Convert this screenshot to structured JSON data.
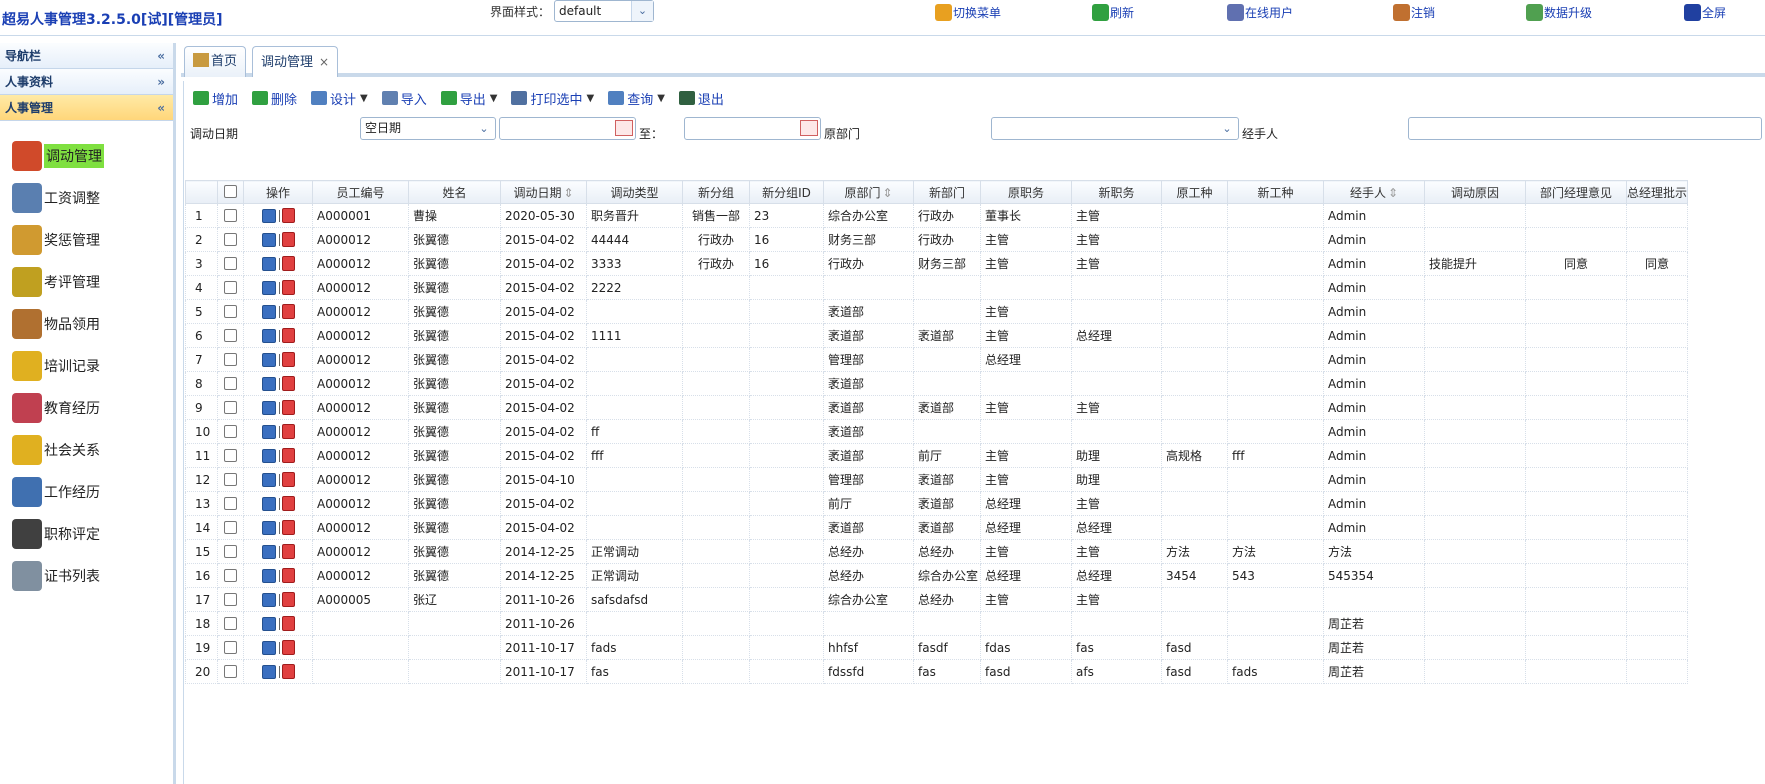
{
  "app": {
    "title": "超易人事管理3.2.5.0[试][管理员]",
    "style_label": "界面样式：",
    "style_value": "default"
  },
  "top_buttons": [
    {
      "label": "切换菜单",
      "icon": "switch-menu-icon",
      "color": "#e8a020"
    },
    {
      "label": "刷新",
      "icon": "refresh-icon",
      "color": "#30a040"
    },
    {
      "label": "在线用户",
      "icon": "online-users-icon",
      "color": "#6070b0"
    },
    {
      "label": "注销",
      "icon": "logout-icon",
      "color": "#c07030"
    },
    {
      "label": "数据升级",
      "icon": "data-upgrade-icon",
      "color": "#50a050"
    },
    {
      "label": "全屏",
      "icon": "fullscreen-icon",
      "color": "#2040a0"
    }
  ],
  "sidebar": {
    "headers": [
      {
        "label": "导航栏",
        "arrow": "«"
      },
      {
        "label": "人事资料",
        "arrow": "»"
      },
      {
        "label": "人事管理",
        "arrow": "«"
      }
    ],
    "items": [
      {
        "label": "调动管理",
        "icon": "transfer-icon",
        "color": "#d04a2a"
      },
      {
        "label": "工资调整",
        "icon": "salary-icon",
        "color": "#5a7fb0"
      },
      {
        "label": "奖惩管理",
        "icon": "reward-icon",
        "color": "#d09a30"
      },
      {
        "label": "考评管理",
        "icon": "evaluation-icon",
        "color": "#c0a020"
      },
      {
        "label": "物品领用",
        "icon": "items-icon",
        "color": "#b07030"
      },
      {
        "label": "培训记录",
        "icon": "training-icon",
        "color": "#e0b020"
      },
      {
        "label": "教育经历",
        "icon": "education-icon",
        "color": "#c04050"
      },
      {
        "label": "社会关系",
        "icon": "relations-icon",
        "color": "#e0b020"
      },
      {
        "label": "工作经历",
        "icon": "work-history-icon",
        "color": "#4070b0"
      },
      {
        "label": "职称评定",
        "icon": "title-rating-icon",
        "color": "#404040"
      },
      {
        "label": "证书列表",
        "icon": "certificate-icon",
        "color": "#8090a0"
      }
    ]
  },
  "tabs": [
    {
      "label": "首页",
      "icon": "home-icon"
    },
    {
      "label": "调动管理",
      "close": "×"
    }
  ],
  "toolbar": [
    {
      "label": "增加",
      "icon": "add-icon",
      "color": "#30a040",
      "dropdown": false
    },
    {
      "label": "删除",
      "icon": "delete-icon",
      "color": "#30a040",
      "dropdown": false
    },
    {
      "label": "设计",
      "icon": "design-icon",
      "color": "#5080c0",
      "dropdown": true
    },
    {
      "label": "导入",
      "icon": "import-icon",
      "color": "#6080b0",
      "dropdown": false
    },
    {
      "label": "导出",
      "icon": "export-icon",
      "color": "#30a040",
      "dropdown": true
    },
    {
      "label": "打印选中",
      "icon": "print-icon",
      "color": "#5070a0",
      "dropdown": true
    },
    {
      "label": "查询",
      "icon": "query-icon",
      "color": "#5080c0",
      "dropdown": true
    },
    {
      "label": "退出",
      "icon": "exit-icon",
      "color": "#306040",
      "dropdown": false
    }
  ],
  "filter": {
    "date_label": "调动日期",
    "date_mode": "空日期",
    "to_label": "至：",
    "from_dept_label": "原部门",
    "handler_label": "经手人"
  },
  "grid": {
    "columns": [
      "操作",
      "员工编号",
      "姓名",
      "调动日期",
      "调动类型",
      "新分组",
      "新分组ID",
      "原部门",
      "新部门",
      "原职务",
      "新职务",
      "原工种",
      "新工种",
      "经手人",
      "调动原因",
      "部门经理意见",
      "总经理批示"
    ],
    "sort_marks": [
      "",
      "",
      "",
      "⇕",
      "",
      "",
      "",
      "⇕",
      "",
      "",
      "",
      "",
      "",
      "⇕",
      "",
      "",
      ""
    ],
    "rows": [
      [
        "1",
        "A000001",
        "曹操",
        "2020-05-30",
        "职务晋升",
        "销售一部",
        "23",
        "综合办公室",
        "行政办",
        "董事长",
        "主管",
        "",
        "",
        "Admin",
        "",
        "",
        ""
      ],
      [
        "2",
        "A000012",
        "张翼德",
        "2015-04-02",
        "44444",
        "行政办",
        "16",
        "财务三部",
        "行政办",
        "主管",
        "主管",
        "",
        "",
        "Admin",
        "",
        "",
        ""
      ],
      [
        "3",
        "A000012",
        "张翼德",
        "2015-04-02",
        "3333",
        "行政办",
        "16",
        "行政办",
        "财务三部",
        "主管",
        "主管",
        "",
        "",
        "Admin",
        "技能提升",
        "同意",
        "同意"
      ],
      [
        "4",
        "A000012",
        "张翼德",
        "2015-04-02",
        "2222",
        "",
        "",
        "",
        "",
        "",
        "",
        "",
        "",
        "Admin",
        "",
        "",
        ""
      ],
      [
        "5",
        "A000012",
        "张翼德",
        "2015-04-02",
        "",
        "",
        "",
        "袤道部",
        "",
        "主管",
        "",
        "",
        "",
        "Admin",
        "",
        "",
        ""
      ],
      [
        "6",
        "A000012",
        "张翼德",
        "2015-04-02",
        "1111",
        "",
        "",
        "袤道部",
        "袤道部",
        "主管",
        "总经理",
        "",
        "",
        "Admin",
        "",
        "",
        ""
      ],
      [
        "7",
        "A000012",
        "张翼德",
        "2015-04-02",
        "",
        "",
        "",
        "管理部",
        "",
        "总经理",
        "",
        "",
        "",
        "Admin",
        "",
        "",
        ""
      ],
      [
        "8",
        "A000012",
        "张翼德",
        "2015-04-02",
        "",
        "",
        "",
        "袤道部",
        "",
        "",
        "",
        "",
        "",
        "Admin",
        "",
        "",
        ""
      ],
      [
        "9",
        "A000012",
        "张翼德",
        "2015-04-02",
        "",
        "",
        "",
        "袤道部",
        "袤道部",
        "主管",
        "主管",
        "",
        "",
        "Admin",
        "",
        "",
        ""
      ],
      [
        "10",
        "A000012",
        "张翼德",
        "2015-04-02",
        "ff",
        "",
        "",
        "袤道部",
        "",
        "",
        "",
        "",
        "",
        "Admin",
        "",
        "",
        ""
      ],
      [
        "11",
        "A000012",
        "张翼德",
        "2015-04-02",
        "fff",
        "",
        "",
        "袤道部",
        "前厅",
        "主管",
        "助理",
        "高规格",
        "fff",
        "Admin",
        "",
        "",
        ""
      ],
      [
        "12",
        "A000012",
        "张翼德",
        "2015-04-10",
        "",
        "",
        "",
        "管理部",
        "袤道部",
        "主管",
        "助理",
        "",
        "",
        "Admin",
        "",
        "",
        ""
      ],
      [
        "13",
        "A000012",
        "张翼德",
        "2015-04-02",
        "",
        "",
        "",
        "前厅",
        "袤道部",
        "总经理",
        "主管",
        "",
        "",
        "Admin",
        "",
        "",
        ""
      ],
      [
        "14",
        "A000012",
        "张翼德",
        "2015-04-02",
        "",
        "",
        "",
        "袤道部",
        "袤道部",
        "总经理",
        "总经理",
        "",
        "",
        "Admin",
        "",
        "",
        ""
      ],
      [
        "15",
        "A000012",
        "张翼德",
        "2014-12-25",
        "正常调动",
        "",
        "",
        "总经办",
        "总经办",
        "主管",
        "主管",
        "方法",
        "方法",
        "方法",
        "",
        "",
        ""
      ],
      [
        "16",
        "A000012",
        "张翼德",
        "2014-12-25",
        "正常调动",
        "",
        "",
        "总经办",
        "综合办公室",
        "总经理",
        "总经理",
        "3454",
        "543",
        "545354",
        "",
        "",
        ""
      ],
      [
        "17",
        "A000005",
        "张辽",
        "2011-10-26",
        "safsdafsd",
        "",
        "",
        "综合办公室",
        "总经办",
        "主管",
        "主管",
        "",
        "",
        "",
        "",
        "",
        ""
      ],
      [
        "18",
        "",
        "",
        "2011-10-26",
        "",
        "",
        "",
        "",
        "",
        "",
        "",
        "",
        "",
        "周芷若",
        "",
        "",
        ""
      ],
      [
        "19",
        "",
        "",
        "2011-10-17",
        "fads",
        "",
        "",
        "hhfsf",
        "fasdf",
        "fdas",
        "fas",
        "fasd",
        "",
        "周芷若",
        "",
        "",
        ""
      ],
      [
        "20",
        "",
        "",
        "2011-10-17",
        "fas",
        "",
        "",
        "fdssfd",
        "fas",
        "fasd",
        "afs",
        "fasd",
        "fads",
        "周芷若",
        "",
        "",
        ""
      ]
    ]
  }
}
